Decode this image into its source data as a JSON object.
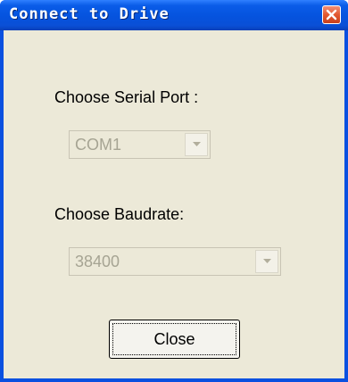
{
  "window": {
    "title": "Connect to Drive"
  },
  "serial_port": {
    "label": "Choose Serial Port :",
    "value": "COM1"
  },
  "baudrate": {
    "label": "Choose Baudrate:",
    "value": "38400"
  },
  "buttons": {
    "close_label": "Close"
  },
  "colors": {
    "title_bar": "#0553de",
    "client_bg": "#ece9d8",
    "disabled_text": "#a6a493",
    "close_button": "#e2582f"
  },
  "icons": {
    "window_close": "close-icon",
    "dropdown": "chevron-down-icon"
  }
}
